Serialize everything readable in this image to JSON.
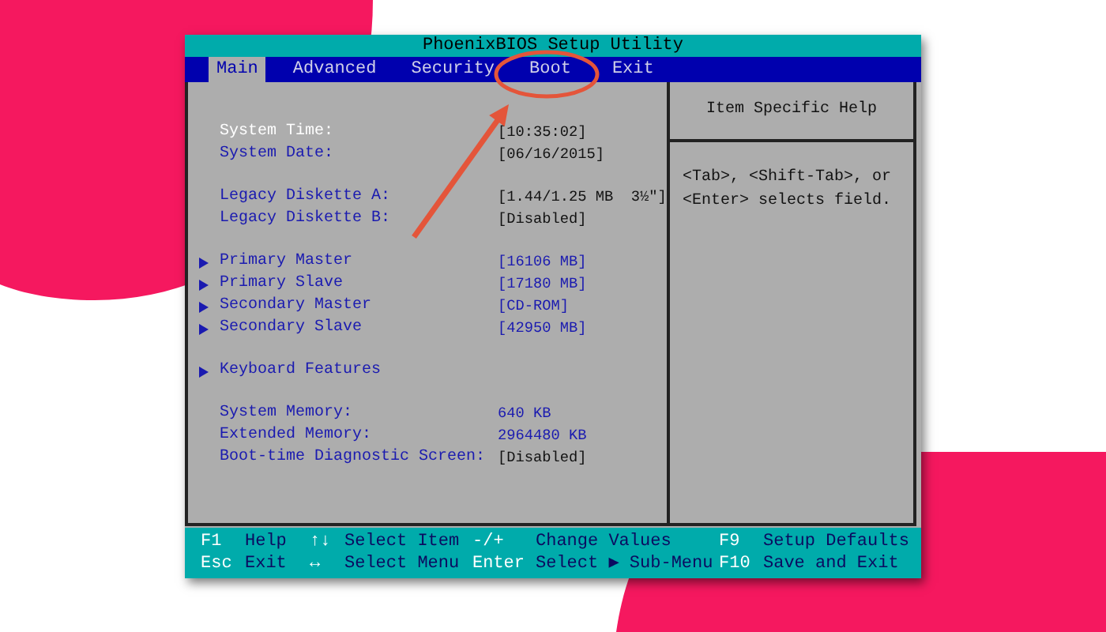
{
  "window": {
    "title": "PhoenixBIOS Setup Utility"
  },
  "menu": [
    {
      "label": "Main",
      "selected": true
    },
    {
      "label": "Advanced",
      "selected": false
    },
    {
      "label": "Security",
      "selected": false
    },
    {
      "label": "Boot",
      "selected": false
    },
    {
      "label": "Exit",
      "selected": false
    }
  ],
  "settings": [
    {
      "rows": [
        {
          "kind": "option",
          "label": "System Time:",
          "value": "[10:35:02]",
          "selected": true
        },
        {
          "kind": "option",
          "label": "System Date:",
          "value": "[06/16/2015]",
          "selected": false
        }
      ]
    },
    {
      "rows": [
        {
          "kind": "option",
          "label": "Legacy Diskette A:",
          "value": "[1.44/1.25 MB  3½\"]",
          "selected": false
        },
        {
          "kind": "option",
          "label": "Legacy Diskette B:",
          "value": "[Disabled]",
          "selected": false
        }
      ]
    },
    {
      "rows": [
        {
          "kind": "submenu",
          "label": "Primary Master",
          "value": "[16106 MB]",
          "selected": false
        },
        {
          "kind": "submenu",
          "label": "Primary Slave",
          "value": "[17180 MB]",
          "selected": false
        },
        {
          "kind": "submenu",
          "label": "Secondary Master",
          "value": "[CD-ROM]",
          "selected": false
        },
        {
          "kind": "submenu",
          "label": "Secondary Slave",
          "value": "[42950 MB]",
          "selected": false
        }
      ]
    },
    {
      "rows": [
        {
          "kind": "submenu",
          "label": "Keyboard Features",
          "selected": false
        }
      ]
    },
    {
      "rows": [
        {
          "kind": "info",
          "label": "System Memory:",
          "value": "640 KB",
          "selected": false
        },
        {
          "kind": "info",
          "label": "Extended Memory:",
          "value": "2964480 KB",
          "selected": false
        },
        {
          "kind": "option",
          "label": "Boot-time Diagnostic Screen:",
          "value": "[Disabled]",
          "selected": false
        }
      ]
    }
  ],
  "help": {
    "title": "Item Specific Help",
    "text": "<Tab>, <Shift-Tab>, or <Enter> selects field."
  },
  "footer": [
    [
      {
        "key": "F1",
        "action": "Help"
      },
      {
        "key": "↑↓",
        "action": "Select Item"
      },
      {
        "key": "-/+",
        "action": "Change Values"
      },
      {
        "key": "F9",
        "action": "Setup Defaults"
      }
    ],
    [
      {
        "key": "Esc",
        "action": "Exit"
      },
      {
        "key": "↔",
        "action": "Select Menu"
      },
      {
        "key": "Enter",
        "action": "Select ▶ Sub-Menu"
      },
      {
        "key": "F10",
        "action": "Save and Exit"
      }
    ]
  ]
}
